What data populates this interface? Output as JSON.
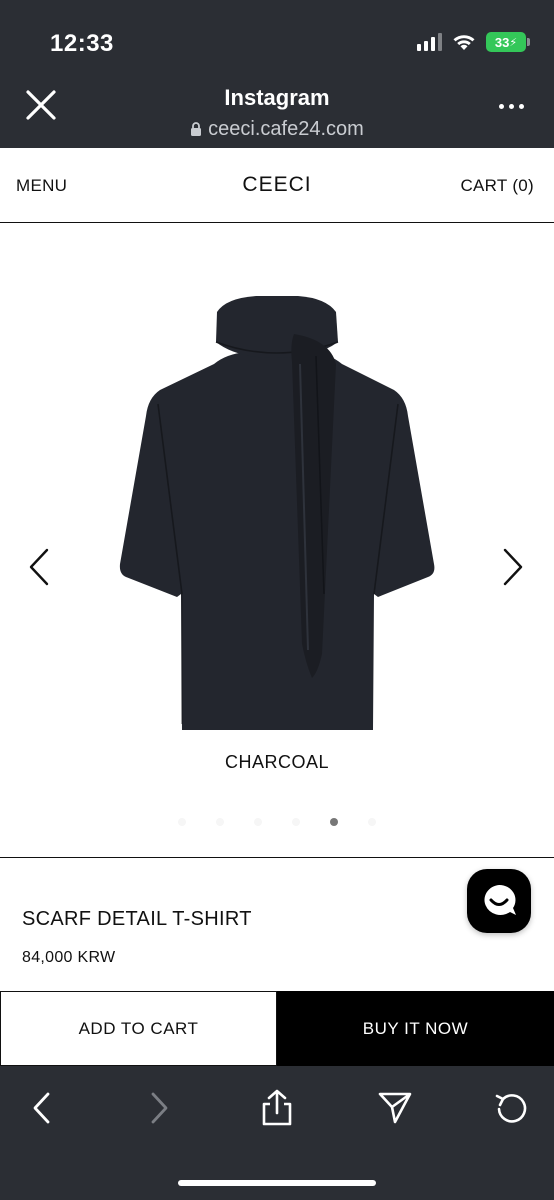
{
  "status_bar": {
    "time": "12:33",
    "battery": "33",
    "icons": [
      "cellular-signal-icon",
      "wifi-icon",
      "battery-charging-icon"
    ]
  },
  "browser_header": {
    "title": "Instagram",
    "url": "ceeci.cafe24.com",
    "icons": [
      "close-icon",
      "lock-icon",
      "more-icon"
    ]
  },
  "site_nav": {
    "menu": "MENU",
    "brand": "CEECI",
    "cart": "CART (0)"
  },
  "gallery": {
    "color_caption": "CHARCOAL",
    "slide_count": 6,
    "active_slide": 5,
    "product_color": "#23262e",
    "icons": [
      "chevron-left-icon",
      "chevron-right-icon"
    ]
  },
  "product": {
    "name": "SCARF DETAIL T-SHIRT",
    "price": "84,000 KRW"
  },
  "cta": {
    "add_to_cart": "ADD TO CART",
    "buy_now": "BUY IT NOW"
  },
  "toolbar": {
    "icons": [
      "back-icon",
      "forward-icon",
      "share-icon",
      "send-icon",
      "reload-icon"
    ]
  },
  "colors": {
    "chrome_dark": "#2b2e34",
    "battery_green": "#34c759",
    "primary": "#000000"
  }
}
